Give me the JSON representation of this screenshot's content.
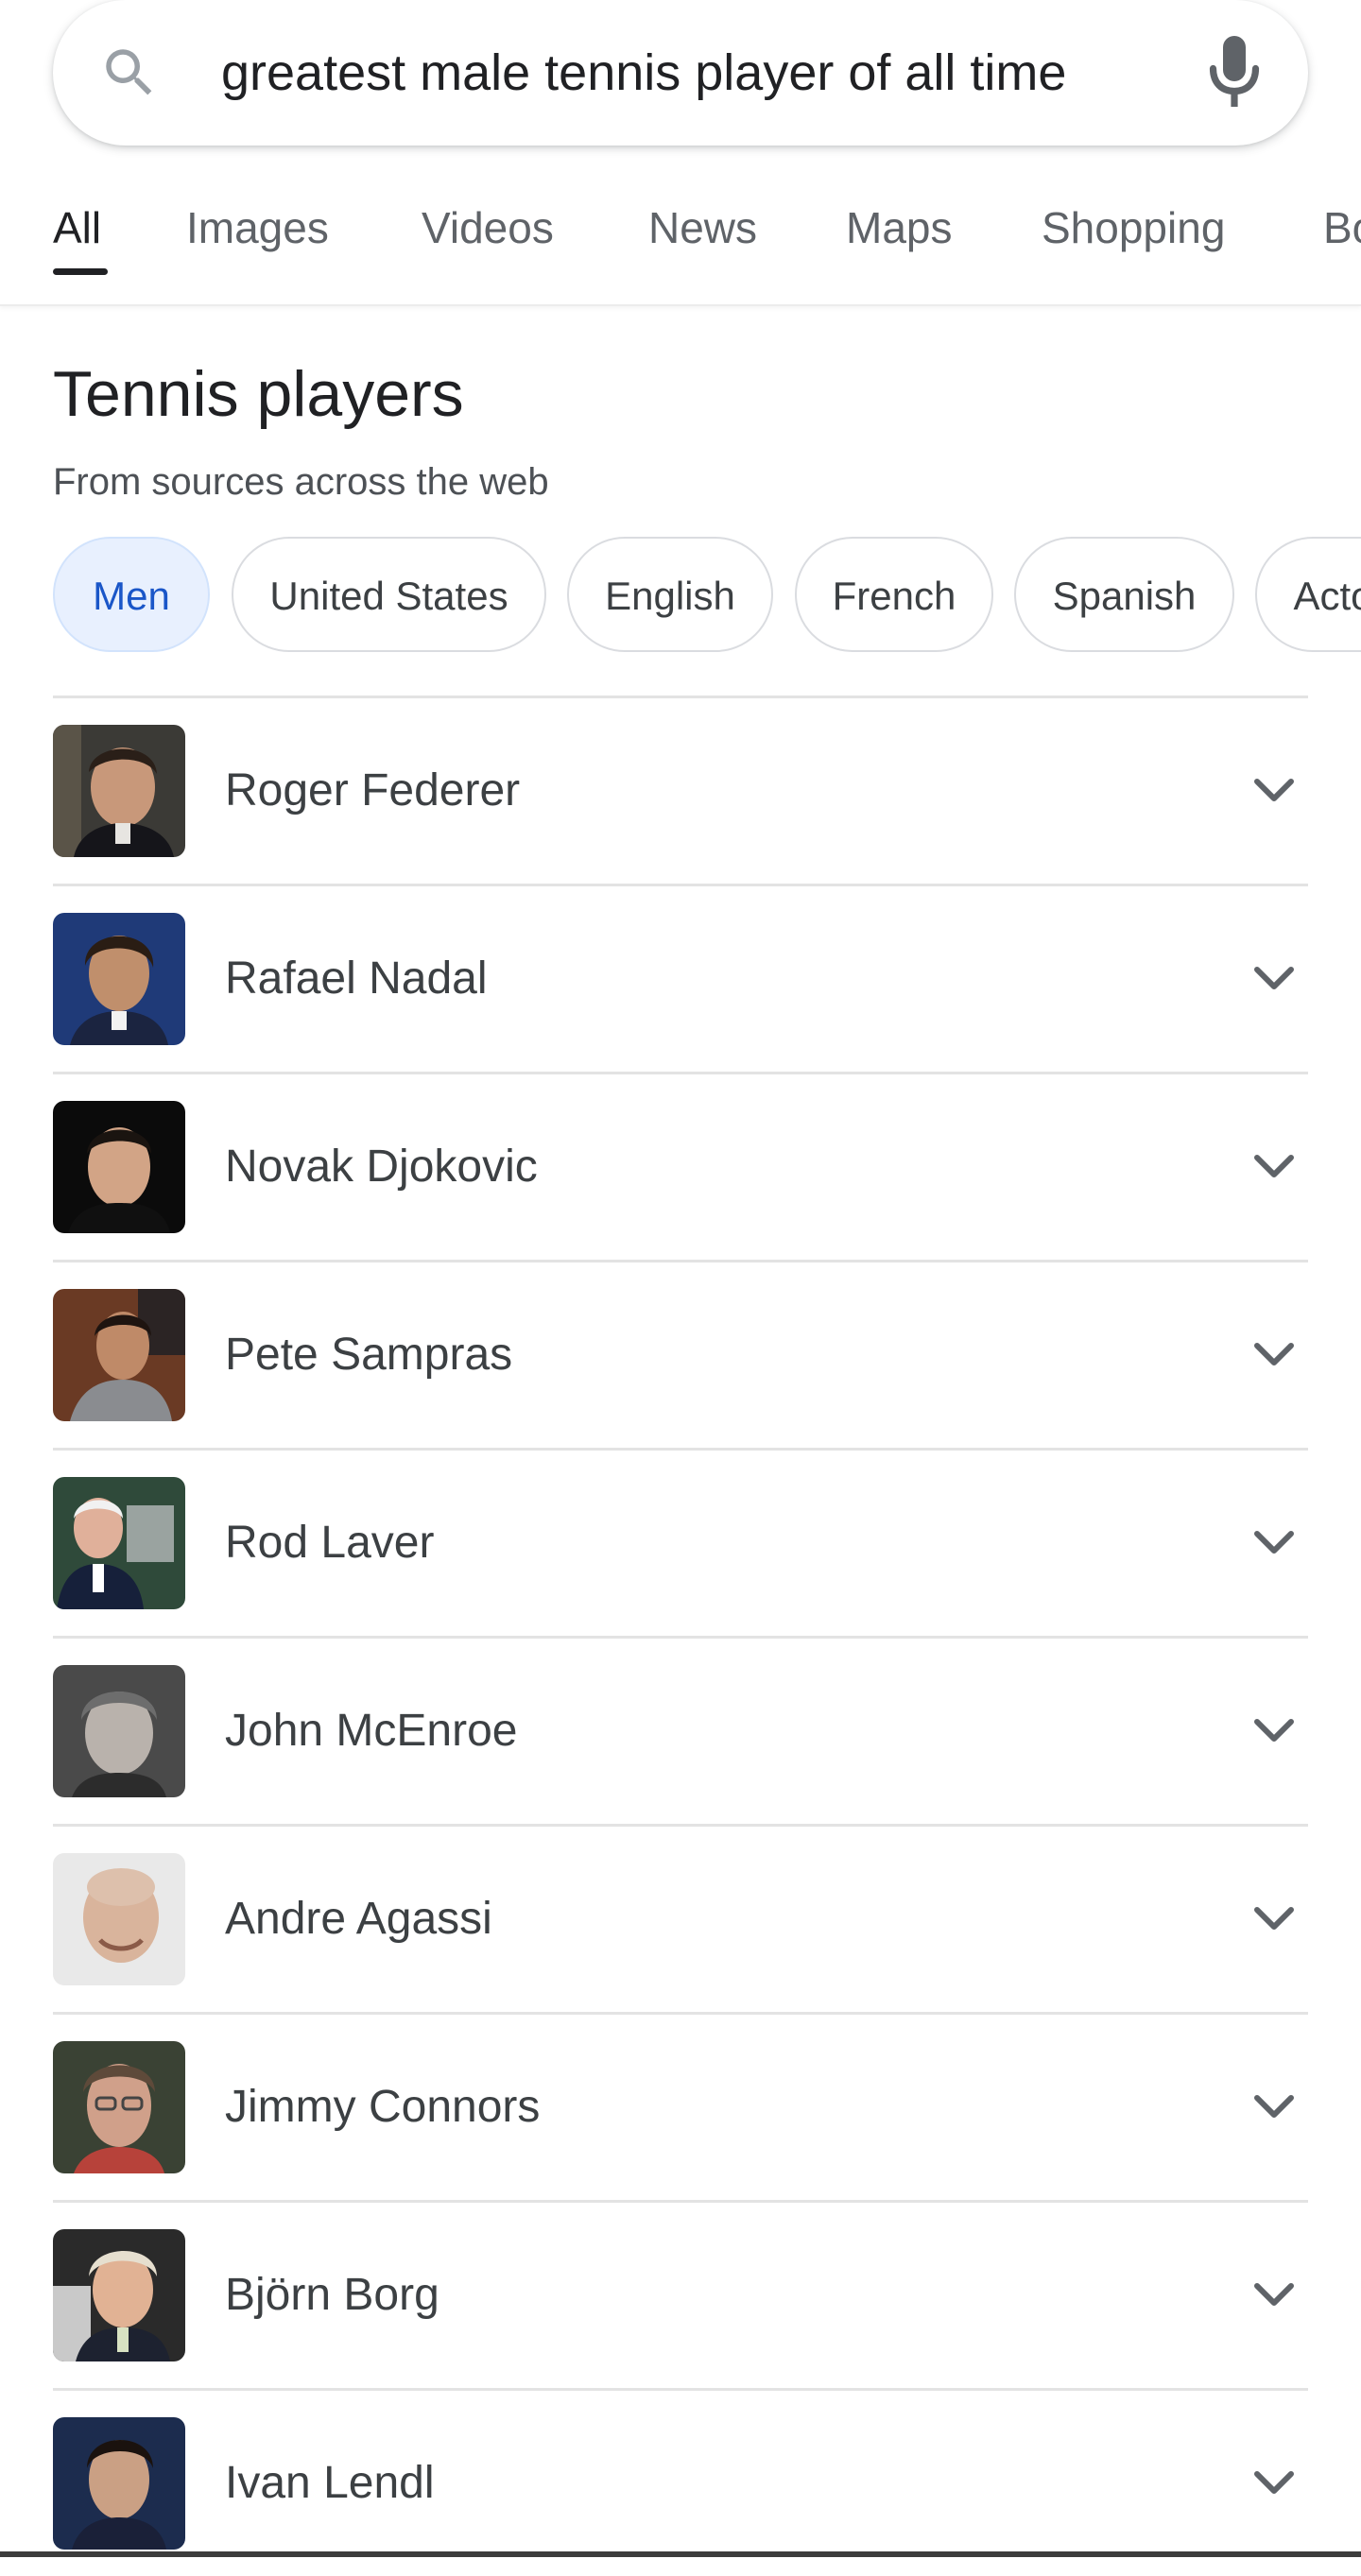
{
  "search": {
    "query": "greatest male tennis player of all time",
    "icon": "search-icon",
    "voice_icon": "mic-icon"
  },
  "tabs": [
    {
      "label": "All",
      "active": true
    },
    {
      "label": "Images",
      "active": false
    },
    {
      "label": "Videos",
      "active": false
    },
    {
      "label": "News",
      "active": false
    },
    {
      "label": "Maps",
      "active": false
    },
    {
      "label": "Shopping",
      "active": false
    },
    {
      "label": "Books",
      "active": false
    }
  ],
  "section": {
    "title": "Tennis players",
    "subtitle": "From sources across the web"
  },
  "chips": [
    {
      "label": "Men",
      "selected": true
    },
    {
      "label": "United States",
      "selected": false
    },
    {
      "label": "English",
      "selected": false
    },
    {
      "label": "French",
      "selected": false
    },
    {
      "label": "Spanish",
      "selected": false
    },
    {
      "label": "Actors",
      "selected": false
    }
  ],
  "players": [
    {
      "name": "Roger Federer",
      "icon": "chevron-down-icon"
    },
    {
      "name": "Rafael Nadal",
      "icon": "chevron-down-icon"
    },
    {
      "name": "Novak Djokovic",
      "icon": "chevron-down-icon"
    },
    {
      "name": "Pete Sampras",
      "icon": "chevron-down-icon"
    },
    {
      "name": "Rod Laver",
      "icon": "chevron-down-icon"
    },
    {
      "name": "John McEnroe",
      "icon": "chevron-down-icon"
    },
    {
      "name": "Andre Agassi",
      "icon": "chevron-down-icon"
    },
    {
      "name": "Jimmy Connors",
      "icon": "chevron-down-icon"
    },
    {
      "name": "Björn Borg",
      "icon": "chevron-down-icon"
    },
    {
      "name": "Ivan Lendl",
      "icon": "chevron-down-icon"
    }
  ],
  "colors": {
    "accent": "#1a73e8",
    "chip_selected_bg": "#e8f0fe",
    "text_primary": "#202124",
    "text_secondary": "#5f6368"
  }
}
